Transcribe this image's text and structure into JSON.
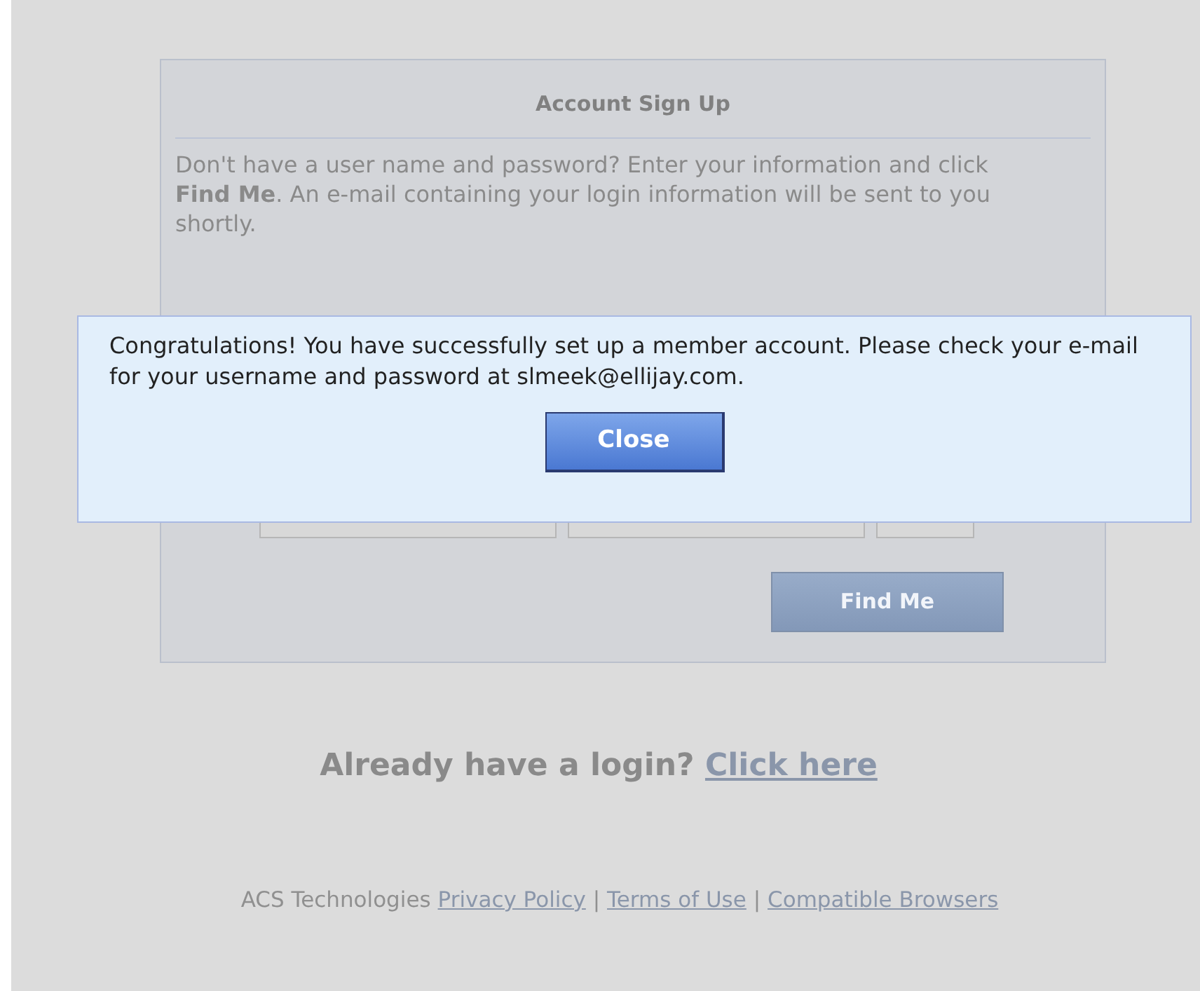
{
  "signup": {
    "title": "Account Sign Up",
    "description": "Don't have a user name and password? Enter your information and click **Find Me**. An e-mail containing your login information will be sent to you shortly.",
    "fields": [
      {
        "kind": "text"
      },
      {
        "kind": "text"
      },
      {
        "kind": "short"
      }
    ],
    "submit": "Find Me"
  },
  "dialog": {
    "message": "Congratulations! You have successfully set up a member account. Please check your e-mail for your username and password at slmeek@ellijay.com.",
    "button": "Close"
  },
  "login_prompt": {
    "text": "Already have a login?",
    "link": "Click here"
  },
  "footer": {
    "company": "ACS Technologies",
    "separator": "|",
    "links": [
      "Privacy Policy",
      "Terms of Use",
      "Compatible Browsers"
    ]
  }
}
